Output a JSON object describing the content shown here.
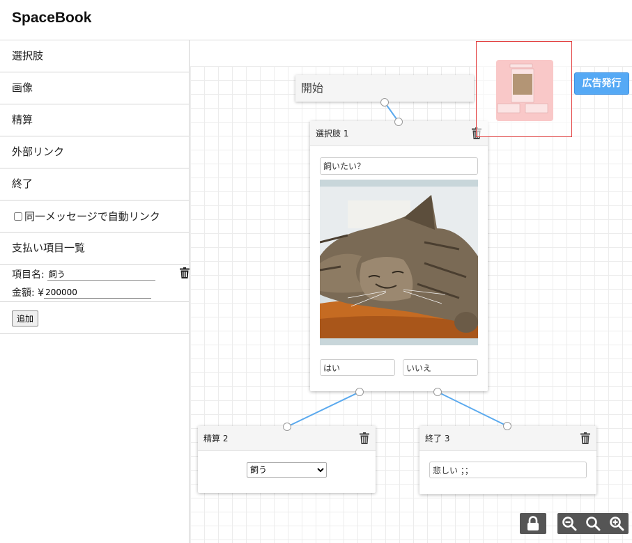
{
  "app": {
    "title": "SpaceBook"
  },
  "sidebar": {
    "items": [
      {
        "label": "選択肢"
      },
      {
        "label": "画像"
      },
      {
        "label": "精算"
      },
      {
        "label": "外部リンク"
      },
      {
        "label": "終了"
      }
    ],
    "auto_link_label": "同一メッセージで自動リンク",
    "auto_link_checked": false,
    "payment": {
      "title": "支払い項目一覧",
      "name_label": "項目名:",
      "name_value": "飼う",
      "amount_label": "金額: ¥",
      "amount_value": "200000",
      "add_label": "追加"
    }
  },
  "canvas": {
    "start_node": {
      "label": "開始"
    },
    "choice_node": {
      "title": "選択肢 1",
      "question": "飼いたい？",
      "option_yes": "はい",
      "option_no": "いいえ"
    },
    "payment_node": {
      "title": "精算 2",
      "selected": "飼う"
    },
    "end_node": {
      "title": "終了 3",
      "message": "悲しい ；；"
    }
  },
  "toolbar": {
    "ad_button": "広告発行"
  },
  "colors": {
    "accent": "#55a9f5",
    "connector": "#5aa9ee",
    "preview_border": "#e23c3c",
    "control_bg": "#555555"
  }
}
